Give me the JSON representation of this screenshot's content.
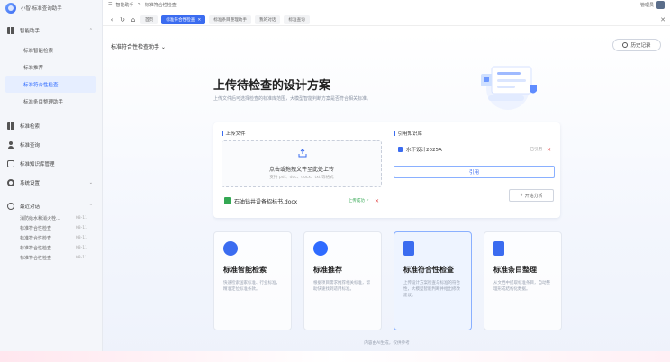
{
  "app": {
    "name": "小智·标准查询助手"
  },
  "topbar": {
    "crumb1": "智能助手",
    "sep": ">",
    "crumb2": "标准符合性检查",
    "user": "管理员"
  },
  "tabs": [
    {
      "label": "首页",
      "active": false
    },
    {
      "label": "标准符合性检查",
      "active": true
    },
    {
      "label": "标准条目整理助手",
      "active": false
    },
    {
      "label": "我的对话",
      "active": false
    },
    {
      "label": "标准查询",
      "active": false
    }
  ],
  "sidebar": {
    "section": "智能助手",
    "sub_items": [
      "标准智能检索",
      "标准推荐",
      "标准符合性检查",
      "标准条目整理助手"
    ],
    "active_index": 2,
    "items": [
      "标准检索",
      "标准查询",
      "标准知识库管理",
      "系统设置"
    ],
    "history_title": "最近对话",
    "history": [
      {
        "title": "消防给水和消火栓…",
        "date": "08-11"
      },
      {
        "title": "标准符合性检查",
        "date": "08-11"
      },
      {
        "title": "标准符合性检查",
        "date": "08-11"
      },
      {
        "title": "标准符合性检查",
        "date": "08-11"
      },
      {
        "title": "标准符合性检查",
        "date": "08-11"
      }
    ]
  },
  "page": {
    "title": "标准符合性检查助手 ⌄",
    "history_button": "历史记录"
  },
  "hero": {
    "title": "上传待检查的设计方案",
    "subtitle": "上传文件后可选择检查的标准库范围，大模型智能判断方案是否符合相关标准。"
  },
  "upload": {
    "label": "上传文件",
    "main": "点击或拖拽文件至此处上传",
    "formats": "支持 pdf、doc、docx、txt 等格式",
    "file_name": "石油钻井设备招标书.docx",
    "file_status": "上传成功 ✓"
  },
  "kb": {
    "label": "引用知识库",
    "item": "水下设计2025A",
    "item_meta": "已引用",
    "select_button": "引用",
    "start_button": "开始分析"
  },
  "cards": [
    {
      "title": "标准智能检索",
      "desc": "快速检索国家标准、行业标准，精准定位标准条款。",
      "color": "#3b6cf0",
      "icon": "robot-icon"
    },
    {
      "title": "标准推荐",
      "desc": "根据项目需求推荐相关标准，帮助快速找到适用标准。",
      "color": "#2f6bff",
      "icon": "q-icon"
    },
    {
      "title": "标准符合性检查",
      "desc": "上传设计方案检查与标准的符合性，大模型智能判断并给出修改建议。",
      "color": "#3b6cf0",
      "icon": "document-chart-icon"
    },
    {
      "title": "标准条目整理",
      "desc": "从文档中提取标准条目，自动整理形成结构化数据。",
      "color": "#3b6cf0",
      "icon": "document-icon"
    }
  ],
  "footer": "内容由AI生成，仅供参考"
}
